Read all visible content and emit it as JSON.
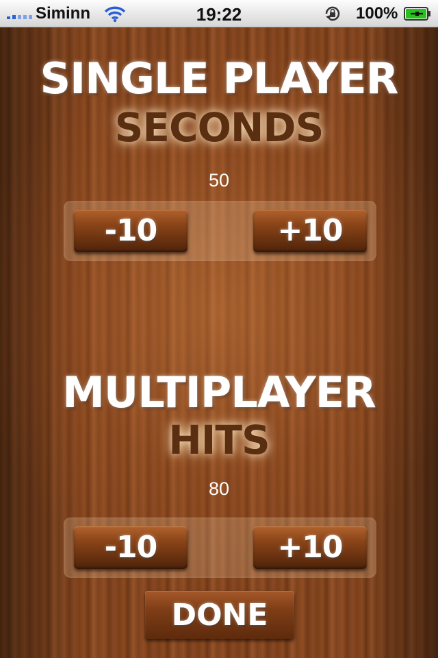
{
  "status_bar": {
    "carrier": "Siminn",
    "time": "19:22",
    "battery_percent": "100%",
    "icons": [
      "signal-icon",
      "wifi-icon",
      "rotation-lock-icon",
      "battery-charging-icon"
    ]
  },
  "single_player": {
    "title": "SINGLE PLAYER",
    "subtitle": "SECONDS",
    "value": "50",
    "decrement_label": "-10",
    "increment_label": "+10"
  },
  "multiplayer": {
    "title": "MULTIPLAYER",
    "subtitle": "HITS",
    "value": "80",
    "decrement_label": "-10",
    "increment_label": "+10"
  },
  "done_label": "DONE",
  "colors": {
    "title_text": "#ffffff",
    "subtitle_text": "#5a2e10",
    "wood_base": "#7a3f19",
    "signal_blue": "#2a5fd6",
    "battery_green": "#27c21d"
  }
}
